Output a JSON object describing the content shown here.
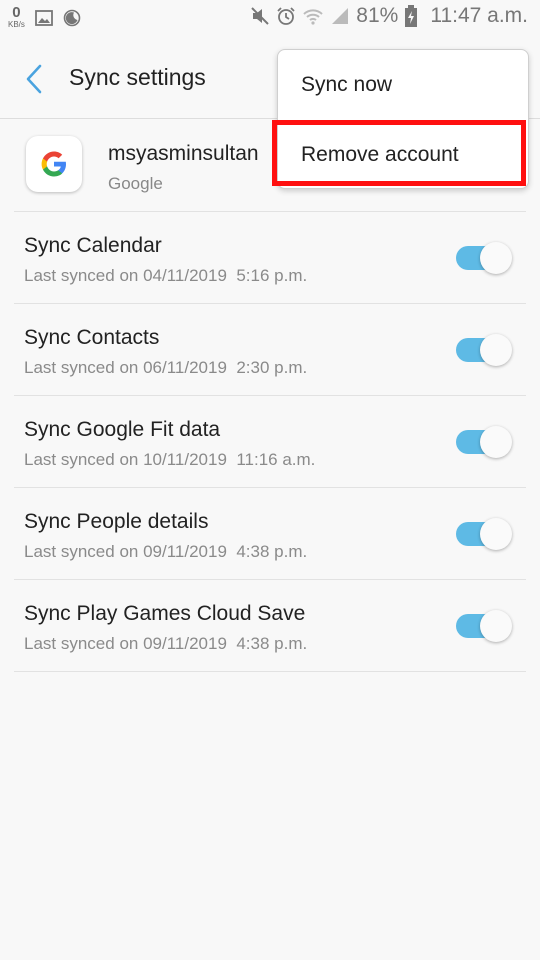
{
  "status_bar": {
    "net_speed_value": "0",
    "net_speed_unit": "KB/s",
    "battery_percent": "81%",
    "time": "11:47 a.m."
  },
  "header": {
    "title": "Sync settings"
  },
  "account": {
    "name": "msyasminsultan",
    "type": "Google",
    "logo_letter": "G"
  },
  "sync_items": [
    {
      "title": "Sync Calendar",
      "subtitle": "Last synced on 04/11/2019  5:16 p.m.",
      "enabled": true
    },
    {
      "title": "Sync Contacts",
      "subtitle": "Last synced on 06/11/2019  2:30 p.m.",
      "enabled": true
    },
    {
      "title": "Sync Google Fit data",
      "subtitle": "Last synced on 10/11/2019  11:16 a.m.",
      "enabled": true
    },
    {
      "title": "Sync People details",
      "subtitle": "Last synced on 09/11/2019  4:38 p.m.",
      "enabled": true
    },
    {
      "title": "Sync Play Games Cloud Save",
      "subtitle": "Last synced on 09/11/2019  4:38 p.m.",
      "enabled": true
    }
  ],
  "menu": {
    "items": [
      "Sync now",
      "Remove account"
    ],
    "highlighted_item": "Remove account"
  },
  "colors": {
    "toggle_on": "#5ebae5",
    "back_arrow": "#4aa3df",
    "highlight_border": "#ff1010"
  }
}
